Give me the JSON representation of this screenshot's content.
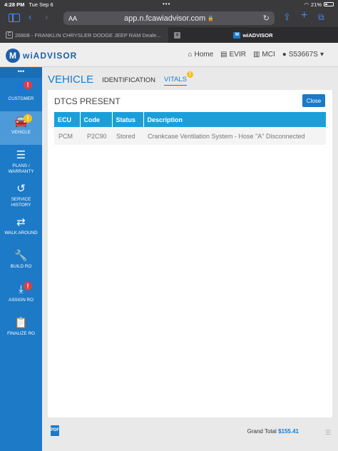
{
  "status_bar": {
    "time": "4:28 PM",
    "date": "Tue Sep 6",
    "battery": "21%"
  },
  "browser": {
    "text_size_label": "AA",
    "url": "app.n.fcawiadvisor.com",
    "tabs": [
      {
        "title": "26808 - FRANKLIN CHRYSLER DODGE JEEP RAM Deale..."
      },
      {
        "title": "wiADVISOR"
      }
    ]
  },
  "app_header": {
    "logo_text": "wiADVISOR",
    "nav": {
      "home": "Home",
      "evir": "EVIR",
      "mci": "MCI",
      "user": "S53667S"
    }
  },
  "sidebar": {
    "top_label": "•••",
    "items": [
      {
        "label": "CUSTOMER",
        "badge": "!"
      },
      {
        "label": "VEHICLE",
        "badge": "!"
      },
      {
        "label": "PLANS / WARRANTY"
      },
      {
        "label": "SERVICE HISTORY"
      },
      {
        "label": "WALK AROUND"
      },
      {
        "label": "BUILD RO"
      },
      {
        "label": "ASSIGN RO",
        "badge": "!"
      },
      {
        "label": "FINALIZE RO"
      }
    ]
  },
  "page": {
    "title": "VEHICLE",
    "tabs": {
      "identification": "IDENTIFICATION",
      "vitals": "VITALS",
      "vitals_badge": "!"
    }
  },
  "dtc_panel": {
    "title": "DTCS PRESENT",
    "close_label": "Close",
    "columns": [
      "ECU",
      "Code",
      "Status",
      "Description"
    ],
    "rows": [
      {
        "ecu": "PCM",
        "code": "P2C90",
        "status": "Stored",
        "description": "Crankcase Ventilation System - Hose \"A\" Disconnected"
      }
    ]
  },
  "footer": {
    "pdf_label": "PDF",
    "grand_total_label": "Grand Total",
    "grand_total_value": "$155.41"
  },
  "colors": {
    "primary": "#1c7ac7",
    "table_header": "#1c9fd9",
    "badge_red": "#e33b4a",
    "badge_yellow": "#f2c21b"
  }
}
